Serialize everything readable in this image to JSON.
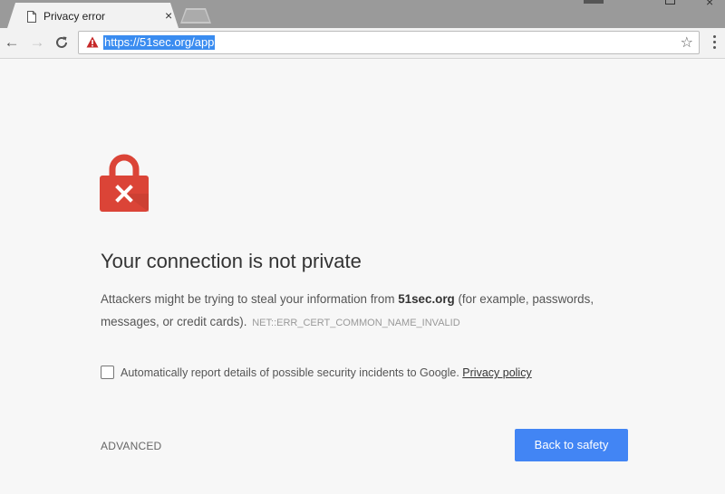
{
  "browser": {
    "tab_title": "Privacy error",
    "tab_close": "×",
    "url": "https://51sec.org/app",
    "back": "←",
    "forward": "→",
    "reload": "C",
    "star": "☆",
    "window_close": "×"
  },
  "page": {
    "heading": "Your connection is not private",
    "body_before": "Attackers might be trying to steal your information from ",
    "domain": "51sec.org",
    "body_after": " (for example, passwords, messages, or credit cards).",
    "error_code": "NET::ERR_CERT_COMMON_NAME_INVALID",
    "checkbox_label": "Automatically report details of possible security incidents to Google.",
    "privacy_link": "Privacy policy",
    "advanced": "ADVANCED",
    "back_to_safety": "Back to safety"
  },
  "colors": {
    "lock_red": "#db4437",
    "primary_blue": "#4285f4",
    "url_highlight": "#3a8cf0",
    "background": "#f7f7f7"
  }
}
